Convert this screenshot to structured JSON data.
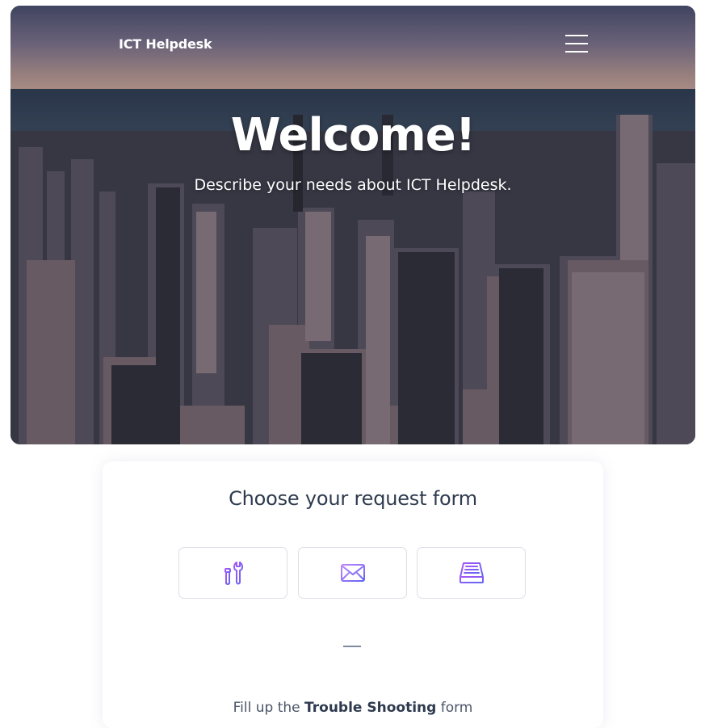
{
  "header": {
    "brand": "ICT Helpdesk",
    "menu_icon": "hamburger-menu-icon"
  },
  "hero": {
    "title": "Welcome!",
    "subtitle": "Describe your needs about ICT Helpdesk."
  },
  "request_card": {
    "title": "Choose your request form",
    "options": [
      {
        "icon": "tools-icon"
      },
      {
        "icon": "mail-icon"
      },
      {
        "icon": "hard-drive-icon"
      }
    ],
    "fill_prefix": "Fill up the",
    "fill_form_name": "Trouble Shooting",
    "fill_suffix": "form"
  },
  "colors": {
    "icon_gradient_start": "#a855f7",
    "icon_gradient_end": "#6366f1",
    "card_title": "#2e3a4e",
    "divider": "#7f8aa2"
  }
}
